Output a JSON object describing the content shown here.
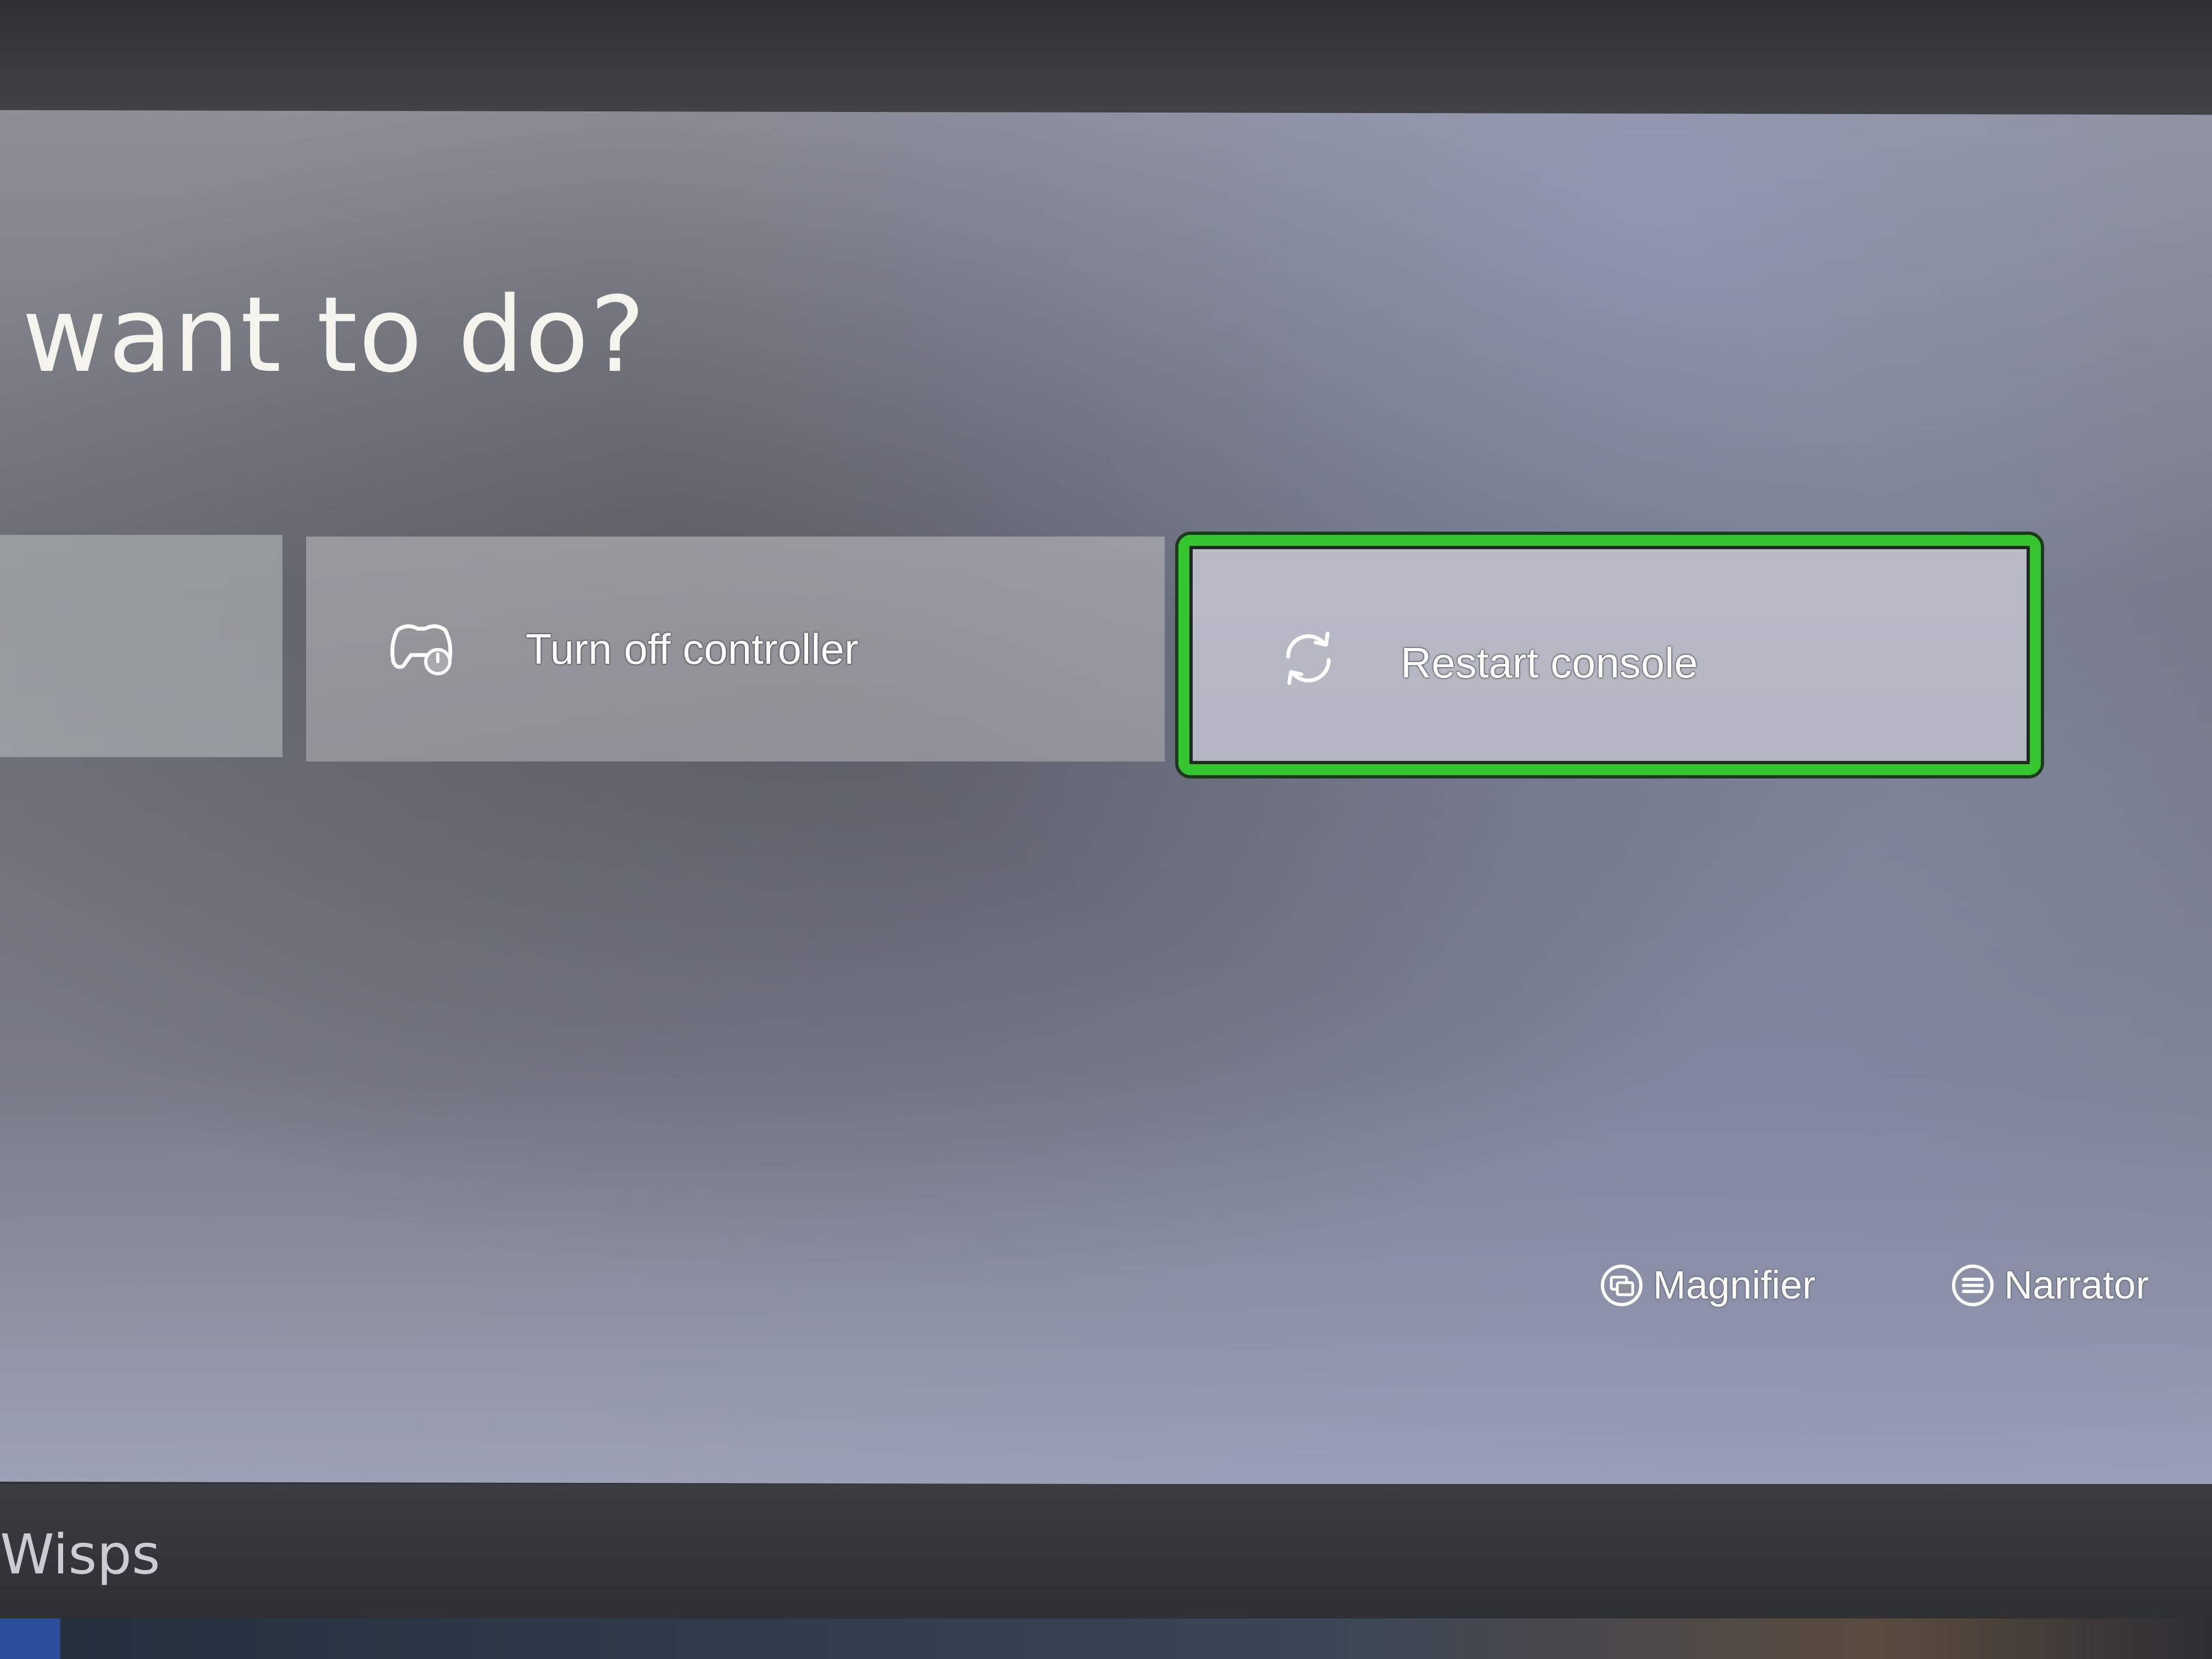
{
  "guide": {
    "title": "want to do?",
    "tiles": [
      {
        "label": "",
        "icon": ""
      },
      {
        "label": "Turn off controller",
        "icon": "controller-power-icon"
      },
      {
        "label": "Restart console",
        "icon": "restart-icon",
        "focused": true
      }
    ],
    "shortcuts": [
      {
        "label": "Magnifier",
        "icon": "view-button-icon"
      },
      {
        "label": "Narrator",
        "icon": "menu-button-icon"
      }
    ]
  },
  "background": {
    "tile_label": "Wisps"
  },
  "colors": {
    "focus_ring": "#34c52f",
    "tile_text": "#ffffff",
    "title_text": "#f4f3ee"
  }
}
